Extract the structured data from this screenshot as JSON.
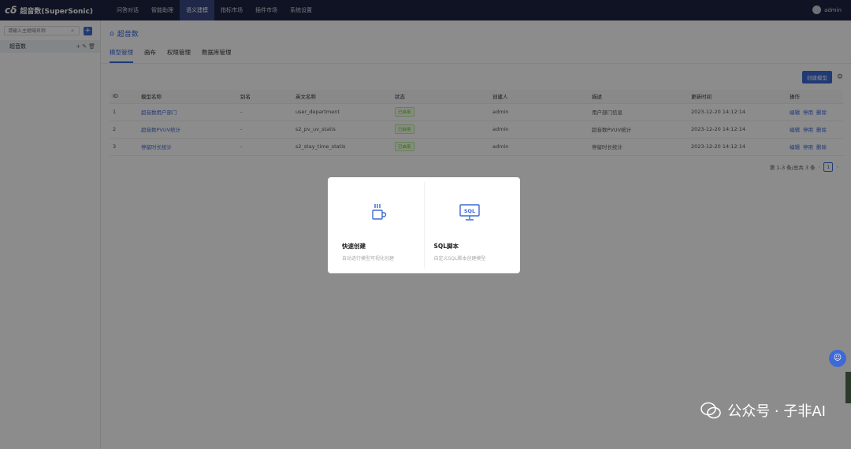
{
  "app": {
    "logo_mark": "cδ",
    "title": "超音数(SuperSonic)"
  },
  "nav": [
    {
      "label": "问答对话",
      "active": false
    },
    {
      "label": "智能助理",
      "active": false
    },
    {
      "label": "语义建模",
      "active": true
    },
    {
      "label": "指标市场",
      "active": false
    },
    {
      "label": "插件市场",
      "active": false
    },
    {
      "label": "系统设置",
      "active": false
    }
  ],
  "user": {
    "name": "admin"
  },
  "sidebar": {
    "search_placeholder": "请输入主题域名称",
    "items": [
      {
        "label": "超音数"
      }
    ]
  },
  "breadcrumb": {
    "label": "超音数"
  },
  "tabs": [
    {
      "label": "模型管理",
      "active": true
    },
    {
      "label": "画布",
      "active": false
    },
    {
      "label": "权限管理",
      "active": false
    },
    {
      "label": "数据库管理",
      "active": false
    }
  ],
  "toolbar": {
    "create_label": "创建模型"
  },
  "table": {
    "headers": [
      "ID",
      "模型名称",
      "别名",
      "英文名称",
      "状态",
      "创建人",
      "描述",
      "更新时间",
      "操作"
    ],
    "rows": [
      {
        "id": "1",
        "name": "超音数用户部门",
        "alias": "-",
        "en": "user_department",
        "status": "已启用",
        "creator": "admin",
        "desc": "用户部门信息",
        "updated": "2023-12-20 14:12:14"
      },
      {
        "id": "2",
        "name": "超音数PVUV统计",
        "alias": "-",
        "en": "s2_pv_uv_statis",
        "status": "已启用",
        "creator": "admin",
        "desc": "超音数PVUV统计",
        "updated": "2023-12-20 14:12:14"
      },
      {
        "id": "3",
        "name": "停留时长统计",
        "alias": "-",
        "en": "s2_stay_time_statis",
        "status": "已启用",
        "creator": "admin",
        "desc": "停留时长统计",
        "updated": "2023-12-20 14:12:14"
      }
    ],
    "ops": [
      "编辑",
      "停用",
      "删除"
    ]
  },
  "pager": {
    "summary": "第 1-3 条/总共 3 条",
    "prev": "‹",
    "page": "1",
    "next": "›"
  },
  "modal": {
    "cards": [
      {
        "title": "快速创建",
        "desc": "自动进行模型可视化创建",
        "icon": "coffee-cup-icon"
      },
      {
        "title": "SQL脚本",
        "desc": "自定义SQL脚本创建模型",
        "icon": "sql-monitor-icon",
        "icon_text": "SQL"
      }
    ]
  },
  "watermark": {
    "text": "公众号 · 子非AI"
  },
  "colors": {
    "nav_bg": "#1c2340",
    "accent": "#3d6ad6",
    "status_green": "#52c41a"
  }
}
